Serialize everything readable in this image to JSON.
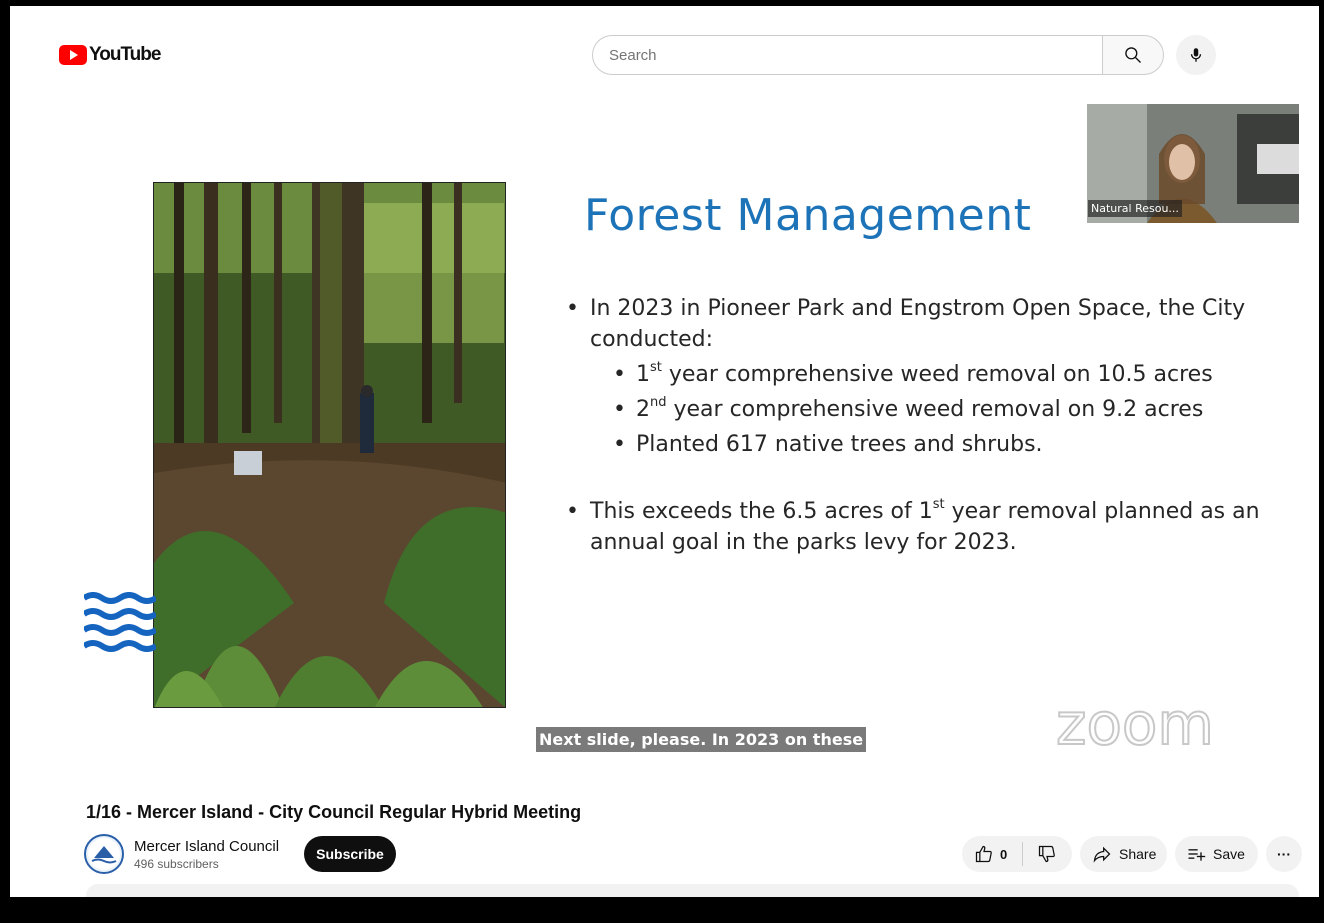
{
  "header": {
    "logo_text": "YouTube",
    "search_placeholder": "Search",
    "icons": [
      "youtube-play-icon",
      "search-icon",
      "mic-icon"
    ]
  },
  "slide": {
    "title": "Forest Management",
    "bullet1": "In 2023 in Pioneer Park and Engstrom Open Space, the City conducted:",
    "sub1_num": "1",
    "sub1_sup": "st",
    "sub1_rest": " year comprehensive weed removal on 10.5 acres",
    "sub2_num": "2",
    "sub2_sup": "nd",
    "sub2_rest": " year comprehensive weed removal on 9.2 acres",
    "sub3": "Planted 617 native trees and shrubs.",
    "bullet2_a": "This exceeds the 6.5 acres of 1",
    "bullet2_sup": "st",
    "bullet2_b": " year removal planned as an annual goal in the parks levy for 2023."
  },
  "pip": {
    "label": "Natural Resou..."
  },
  "caption": "Next slide, please. In 2023 on these",
  "watermark": "zoom",
  "video": {
    "title": "1/16 - Mercer Island - City Council Regular Hybrid Meeting"
  },
  "channel": {
    "name": "Mercer Island Council",
    "subscribers": "496 subscribers",
    "subscribe_label": "Subscribe"
  },
  "actions": {
    "like_count": "0",
    "share_label": "Share",
    "save_label": "Save",
    "more_label": "···"
  },
  "colors": {
    "youtube_red": "#ff0000",
    "slide_title_blue": "#1d73b8",
    "wave_blue": "#1565c0"
  }
}
